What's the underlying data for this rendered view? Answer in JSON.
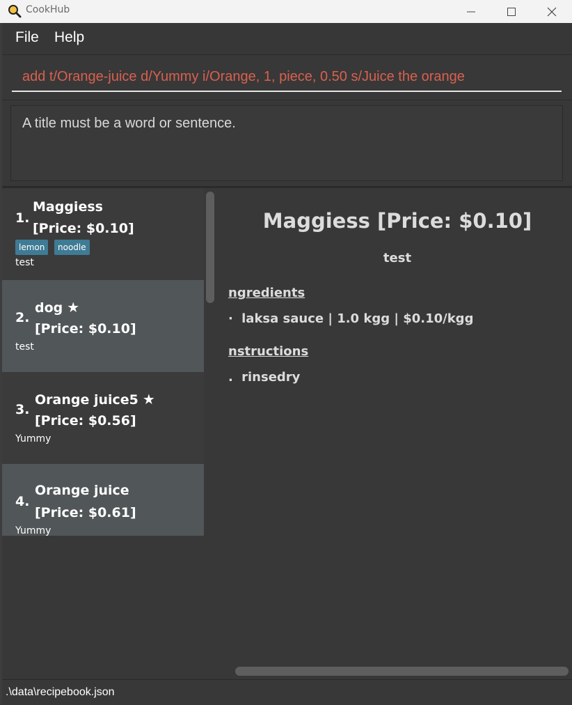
{
  "window": {
    "title": "CookHub",
    "icon": "magnifier-pan-icon",
    "controls": [
      "minimize-icon",
      "maximize-icon",
      "close-icon"
    ]
  },
  "menu": {
    "file": "File",
    "help": "Help"
  },
  "command": {
    "value": "add t/Orange-juice d/Yummy i/Orange, 1, piece, 0.50 s/Juice the orange"
  },
  "result": {
    "message": "A title must be a word or sentence."
  },
  "recipes": [
    {
      "index": "1.",
      "title": "Maggiess",
      "price": "[Price: $0.10]",
      "tags": [
        "lemon",
        "noodle"
      ],
      "description": "test",
      "favourite": false
    },
    {
      "index": "2.",
      "title": "dog",
      "price": "[Price: $0.10]",
      "tags": [],
      "description": "test",
      "favourite": true
    },
    {
      "index": "3.",
      "title": "Orange juice5",
      "price": "[Price: $0.56]",
      "tags": [],
      "description": "Yummy",
      "favourite": true
    },
    {
      "index": "4.",
      "title": "Orange juice",
      "price": "[Price: $0.61]",
      "tags": [],
      "description": "Yummy",
      "favourite": false
    }
  ],
  "star_glyph": "★",
  "detail": {
    "title": "Maggiess [Price: $0.10]",
    "description": "test",
    "ingredients_heading": "ngredients",
    "ingredients": [
      {
        "bullet": "·",
        "text": "laksa sauce | 1.0 kgg | $0.10/kgg"
      }
    ],
    "instructions_heading": "nstructions",
    "instructions": [
      {
        "bullet": ".",
        "text": "rinsedry"
      }
    ]
  },
  "status": {
    "path": ".\\data\\recipebook.json"
  },
  "colors": {
    "background": "#383838",
    "card_dark": "#3b3b3b",
    "card_light": "#515658",
    "tag": "#3f7b95",
    "command_text": "#d9604f"
  }
}
